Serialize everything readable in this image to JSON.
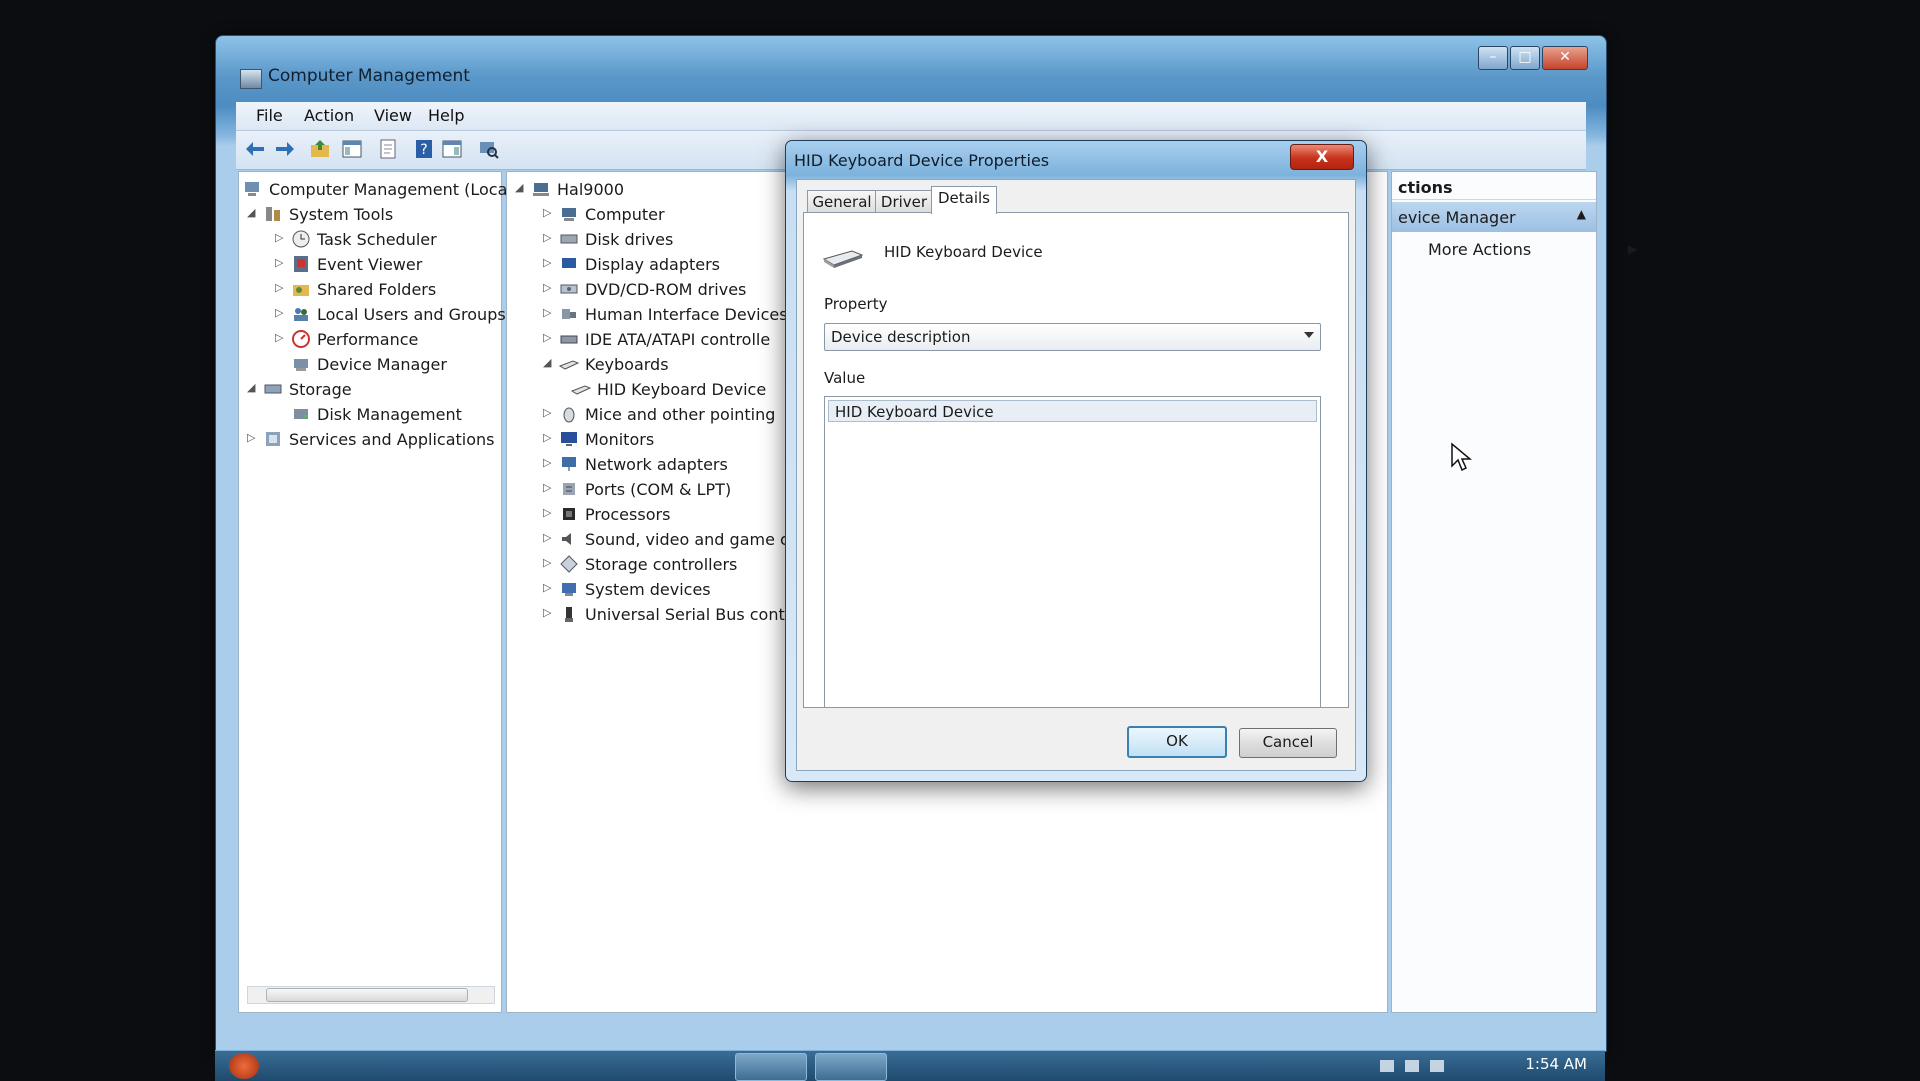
{
  "main_window": {
    "title": "Computer Management",
    "menu": [
      "File",
      "Action",
      "View",
      "Help"
    ]
  },
  "left_tree": {
    "root": "Computer Management (Local",
    "system_tools": "System Tools",
    "system_tools_items": [
      "Task Scheduler",
      "Event Viewer",
      "Shared Folders",
      "Local Users and Groups",
      "Performance",
      "Device Manager"
    ],
    "storage": "Storage",
    "storage_items": [
      "Disk Management"
    ],
    "services": "Services and Applications"
  },
  "device_tree": {
    "root": "Hal9000",
    "items": [
      {
        "label": "Computer",
        "icon": "computer-icon"
      },
      {
        "label": "Disk drives",
        "icon": "disk-drive-icon"
      },
      {
        "label": "Display adapters",
        "icon": "display-adapter-icon"
      },
      {
        "label": "DVD/CD-ROM drives",
        "icon": "dvd-icon"
      },
      {
        "label": "Human Interface Devices",
        "icon": "hid-icon"
      },
      {
        "label": "IDE ATA/ATAPI controlle",
        "icon": "ide-icon"
      },
      {
        "label": "Keyboards",
        "icon": "keyboard-icon"
      },
      {
        "label": "HID Keyboard Device",
        "icon": "keyboard-icon"
      },
      {
        "label": "Mice and other pointing",
        "icon": "mouse-icon"
      },
      {
        "label": "Monitors",
        "icon": "monitor-icon"
      },
      {
        "label": "Network adapters",
        "icon": "network-icon"
      },
      {
        "label": "Ports (COM & LPT)",
        "icon": "port-icon"
      },
      {
        "label": "Processors",
        "icon": "processor-icon"
      },
      {
        "label": "Sound, video and game c",
        "icon": "sound-icon"
      },
      {
        "label": "Storage controllers",
        "icon": "storage-controller-icon"
      },
      {
        "label": "System devices",
        "icon": "system-devices-icon"
      },
      {
        "label": "Universal Serial Bus contr",
        "icon": "usb-icon"
      }
    ]
  },
  "actions_pane": {
    "header": "ctions",
    "section": "evice Manager",
    "more": "More Actions"
  },
  "dialog": {
    "title": "HID Keyboard Device Properties",
    "close": "X",
    "tabs": [
      "General",
      "Driver",
      "Details"
    ],
    "active_tab": "Details",
    "device_name": "HID Keyboard Device",
    "property_label": "Property",
    "property_value": "Device description",
    "value_label": "Value",
    "value_items": [
      "HID Keyboard Device"
    ],
    "ok": "OK",
    "cancel": "Cancel"
  },
  "taskbar": {
    "time": "1:54 AM"
  }
}
